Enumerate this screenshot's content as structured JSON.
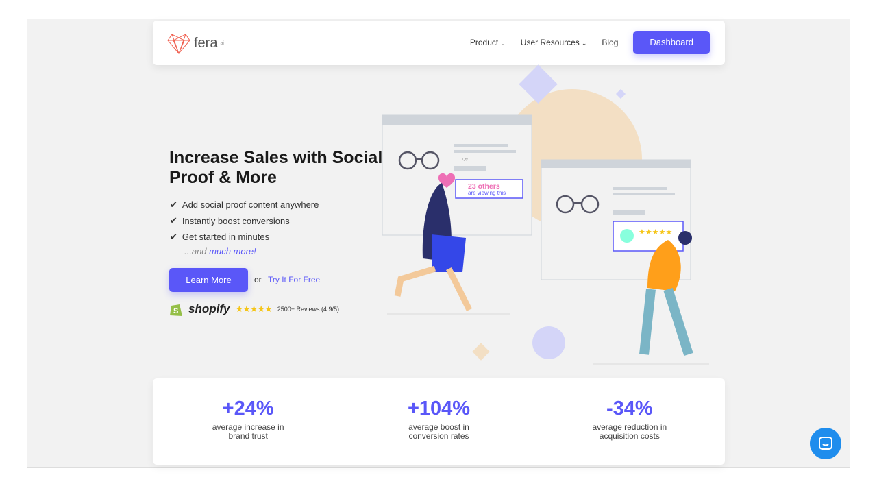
{
  "brand": {
    "name": "fera",
    "suffix": "ai",
    "logo_color": "#f06050"
  },
  "nav": {
    "items": [
      {
        "label": "Product",
        "dropdown": true
      },
      {
        "label": "User Resources",
        "dropdown": true
      },
      {
        "label": "Blog",
        "dropdown": false
      }
    ],
    "cta": "Dashboard"
  },
  "hero": {
    "title": "Increase Sales with Social Proof & More",
    "features": [
      "Add social proof content anywhere",
      "Instantly boost conversions",
      "Get started in minutes"
    ],
    "more_prefix": "...and ",
    "more_link": "much more!",
    "primary_button": "Learn More",
    "or": "or",
    "secondary_link": "Try It For Free",
    "shopify": {
      "name": "shopify",
      "stars": "★★★★★",
      "reviews": "2500+ Reviews (4.9/5)"
    }
  },
  "illustration": {
    "viewing_count": "23 others",
    "viewing_text": "are viewing this",
    "qty": "Qty",
    "review_stars": "★★★★★"
  },
  "stats": [
    {
      "value": "+24%",
      "label": "average increase in brand trust"
    },
    {
      "value": "+104%",
      "label": "average boost in conversion rates"
    },
    {
      "value": "-34%",
      "label": "average reduction in acquisition costs"
    }
  ],
  "colors": {
    "accent": "#5a57f8",
    "chat": "#1f8ded",
    "star": "#f5c518"
  }
}
